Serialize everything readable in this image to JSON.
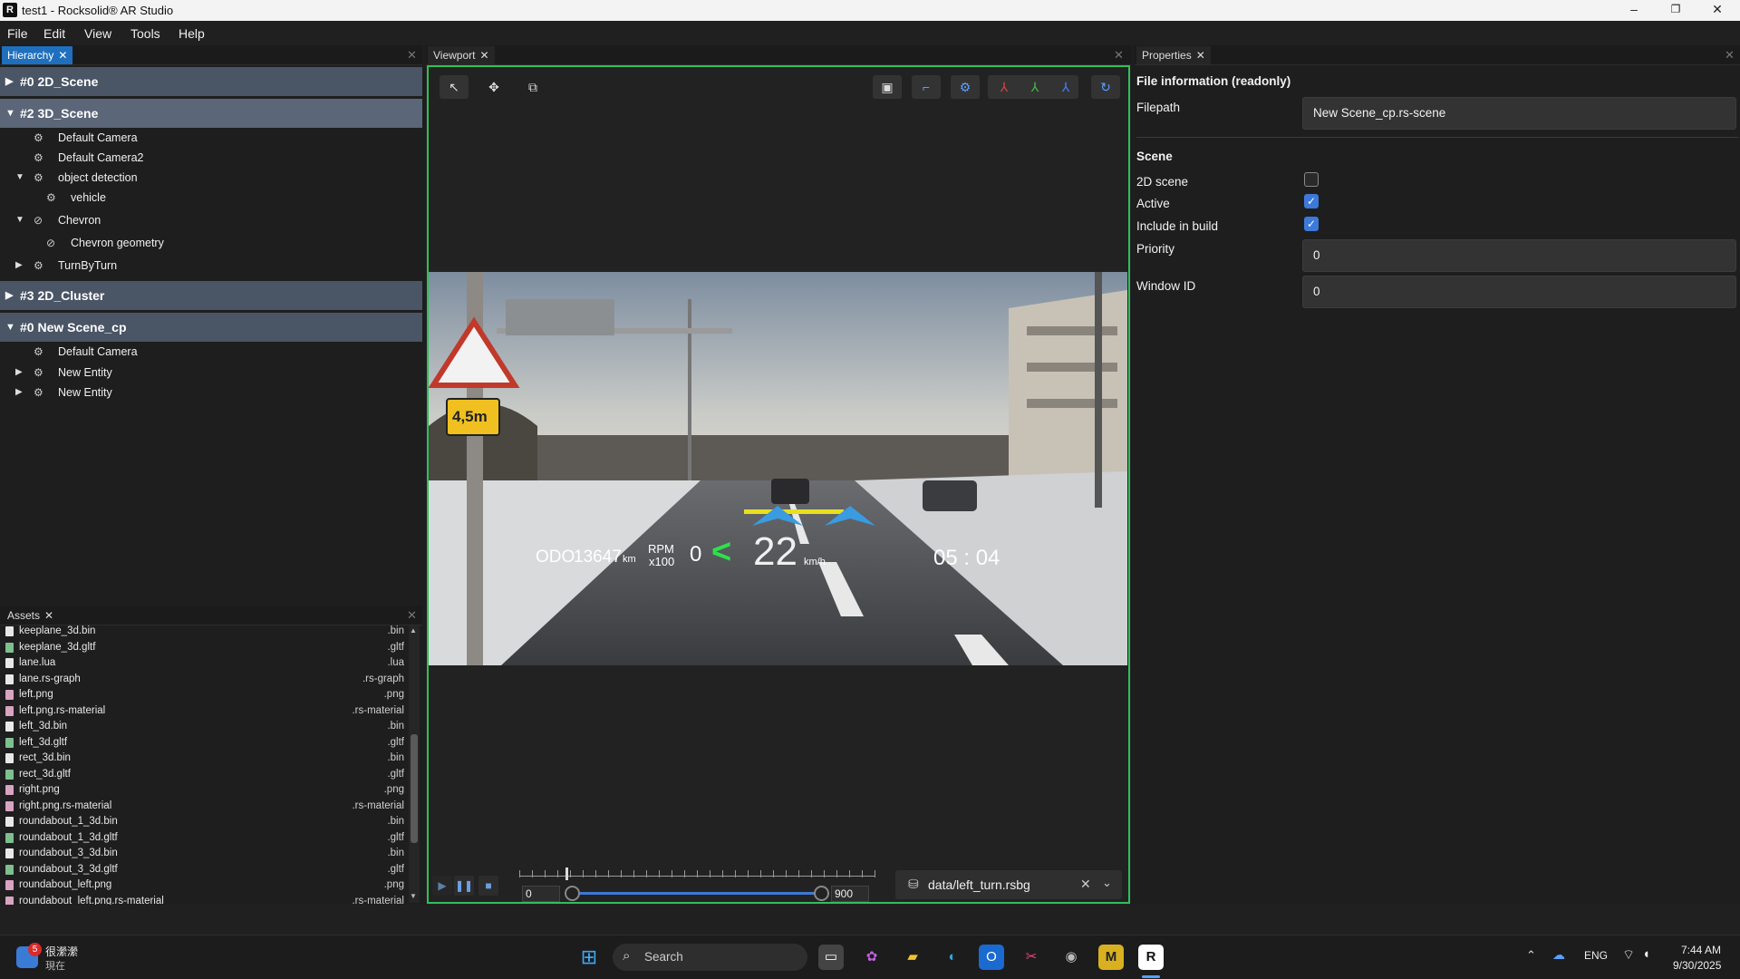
{
  "window": {
    "title": "test1 - Rocksolid® AR Studio",
    "app_logo": "R",
    "controls": {
      "minimize": "–",
      "maximize": "❐",
      "close": "✕"
    }
  },
  "menu": [
    "File",
    "Edit",
    "View",
    "Tools",
    "Help"
  ],
  "hierarchy": {
    "tab_label": "Hierarchy",
    "scenes": [
      {
        "label": "#0 2D_Scene",
        "expanded": false
      },
      {
        "label": "#2 3D_Scene",
        "expanded": true
      },
      {
        "label": "#3 2D_Cluster",
        "expanded": false
      },
      {
        "label": "#0 New Scene_cp",
        "expanded": true
      }
    ],
    "entities_scene2": [
      "Default Camera",
      "Default Camera2",
      "object detection",
      "vehicle",
      "Chevron",
      "Chevron geometry",
      "TurnByTurn"
    ],
    "entities_scene4": [
      "Default Camera",
      "New Entity",
      "New Entity"
    ]
  },
  "assets": {
    "tab_label": "Assets",
    "files": [
      {
        "name": "keeplane_3d.bin",
        "ext": ".bin",
        "kind": "bin"
      },
      {
        "name": "keeplane_3d.gltf",
        "ext": ".gltf",
        "kind": "gltf"
      },
      {
        "name": "lane.lua",
        "ext": ".lua",
        "kind": "bin"
      },
      {
        "name": "lane.rs-graph",
        "ext": ".rs-graph",
        "kind": "bin"
      },
      {
        "name": "left.png",
        "ext": ".png",
        "kind": "png"
      },
      {
        "name": "left.png.rs-material",
        "ext": ".rs-material",
        "kind": "png"
      },
      {
        "name": "left_3d.bin",
        "ext": ".bin",
        "kind": "bin"
      },
      {
        "name": "left_3d.gltf",
        "ext": ".gltf",
        "kind": "gltf"
      },
      {
        "name": "rect_3d.bin",
        "ext": ".bin",
        "kind": "bin"
      },
      {
        "name": "rect_3d.gltf",
        "ext": ".gltf",
        "kind": "gltf"
      },
      {
        "name": "right.png",
        "ext": ".png",
        "kind": "png"
      },
      {
        "name": "right.png.rs-material",
        "ext": ".rs-material",
        "kind": "png"
      },
      {
        "name": "roundabout_1_3d.bin",
        "ext": ".bin",
        "kind": "bin"
      },
      {
        "name": "roundabout_1_3d.gltf",
        "ext": ".gltf",
        "kind": "gltf"
      },
      {
        "name": "roundabout_3_3d.bin",
        "ext": ".bin",
        "kind": "bin"
      },
      {
        "name": "roundabout_3_3d.gltf",
        "ext": ".gltf",
        "kind": "gltf"
      },
      {
        "name": "roundabout_left.png",
        "ext": ".png",
        "kind": "png"
      },
      {
        "name": "roundabout_left.png.rs-material",
        "ext": ".rs-material",
        "kind": "png"
      }
    ]
  },
  "viewport": {
    "tab_label": "Viewport",
    "hud": {
      "odo_label": "ODO",
      "odo_value": "13647",
      "odo_unit": "km",
      "rpm_label": "RPM",
      "rpm_scale": "x100",
      "rpm_value": "0",
      "arrow": "<",
      "speed": "22",
      "speed_unit": "km/h",
      "time": "05 : 04"
    },
    "sign_text": "4,5m",
    "playback": {
      "range_start": "0",
      "range_end": "900",
      "position_fraction": 0.13,
      "file": "data/left_turn.rsbg"
    }
  },
  "properties": {
    "tab_label": "Properties",
    "file_info_heading": "File information (readonly)",
    "filepath_label": "Filepath",
    "filepath_value": "New Scene_cp.rs-scene",
    "scene_heading": "Scene",
    "scene_2d_label": "2D scene",
    "scene_2d_checked": false,
    "active_label": "Active",
    "active_checked": true,
    "include_label": "Include in build",
    "include_checked": true,
    "priority_label": "Priority",
    "priority_value": "0",
    "window_id_label": "Window ID",
    "window_id_value": "0"
  },
  "taskbar": {
    "notification_count": "5",
    "notification_title": "很瀠瀠",
    "notification_sub": "現在",
    "search_placeholder": "Search",
    "language": "ENG",
    "time": "7:44 AM",
    "date": "9/30/2025"
  },
  "colors": {
    "accent": "#1f6fbf",
    "viewport_border": "#2fbf5a",
    "checkbox_on": "#3d79d8",
    "hud_green": "#2ee04a",
    "chevron_blue": "#3a9be0"
  }
}
